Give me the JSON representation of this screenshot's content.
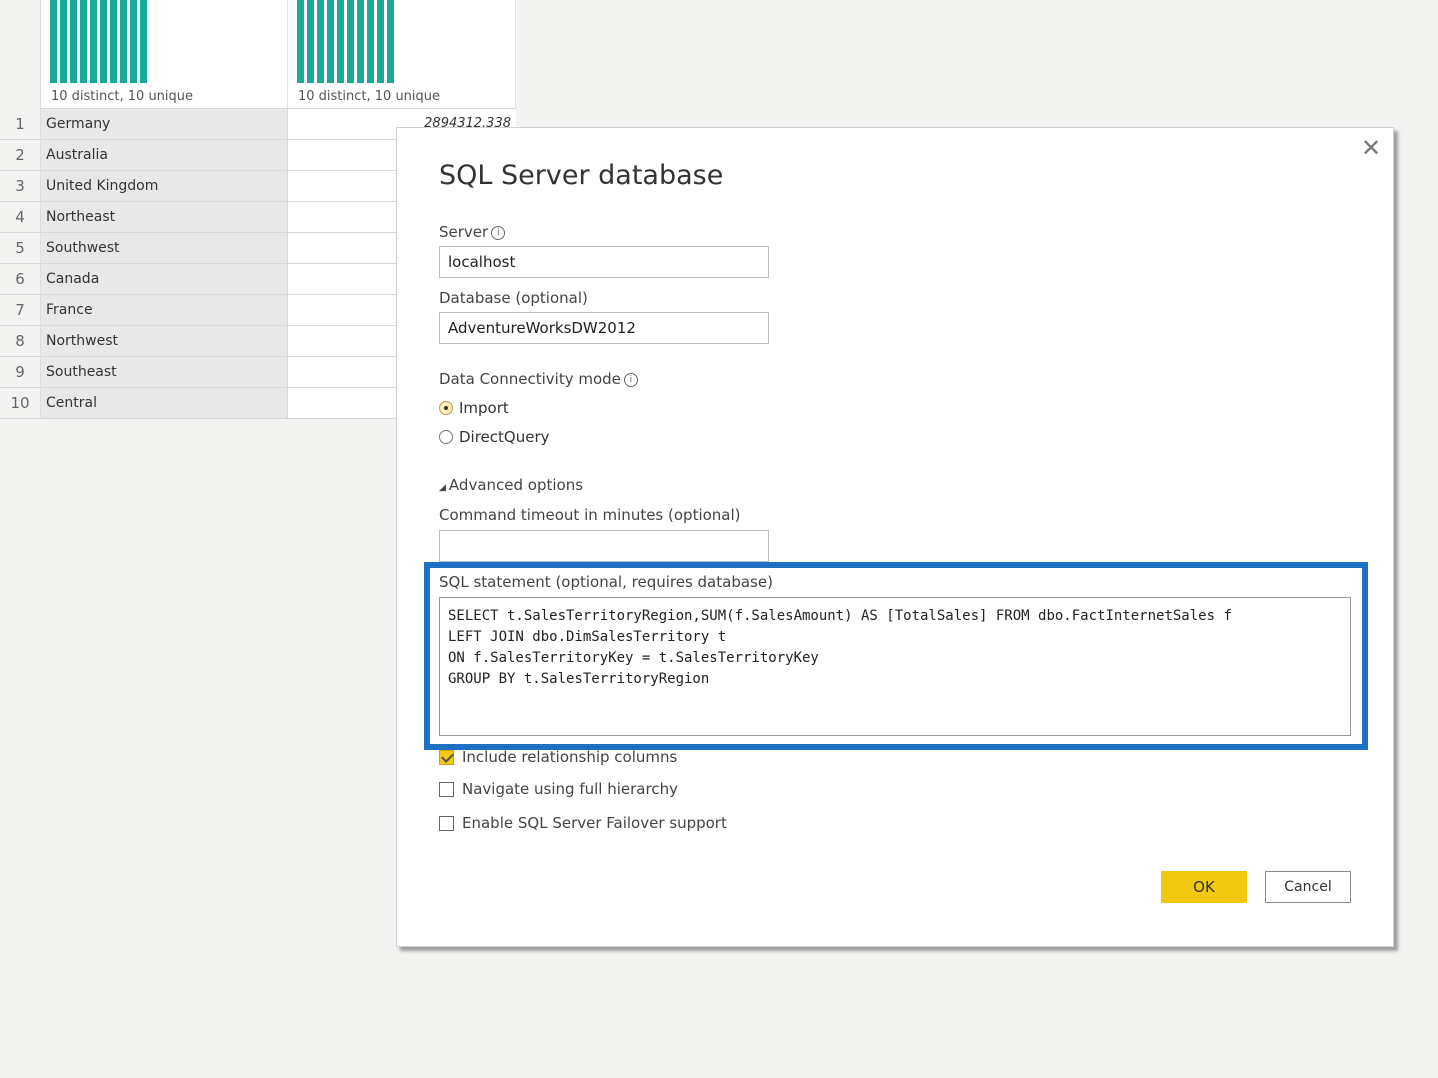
{
  "grid": {
    "columns": [
      {
        "distribution_label": "10 distinct, 10 unique",
        "bar_count": 10
      },
      {
        "distribution_label": "10 distinct, 10 unique",
        "bar_count": 10
      }
    ],
    "rows": [
      {
        "index": "1",
        "region": "Germany",
        "total_sales": "2894312.338"
      },
      {
        "index": "2",
        "region": "Australia",
        "total_sales": ""
      },
      {
        "index": "3",
        "region": "United Kingdom",
        "total_sales": ""
      },
      {
        "index": "4",
        "region": "Northeast",
        "total_sales": ""
      },
      {
        "index": "5",
        "region": "Southwest",
        "total_sales": ""
      },
      {
        "index": "6",
        "region": "Canada",
        "total_sales": ""
      },
      {
        "index": "7",
        "region": "France",
        "total_sales": ""
      },
      {
        "index": "8",
        "region": "Northwest",
        "total_sales": ""
      },
      {
        "index": "9",
        "region": "Southeast",
        "total_sales": ""
      },
      {
        "index": "10",
        "region": "Central",
        "total_sales": ""
      }
    ]
  },
  "dialog": {
    "title": "SQL Server database",
    "close_icon": "close-icon",
    "server_label": "Server",
    "server_value": "localhost",
    "database_label": "Database (optional)",
    "database_value": "AdventureWorksDW2012",
    "connectivity_label": "Data Connectivity mode",
    "info_icon": "i",
    "modes": [
      {
        "label": "Import",
        "selected": true
      },
      {
        "label": "DirectQuery",
        "selected": false
      }
    ],
    "advanced_label": "Advanced options",
    "advanced_icon": "◢",
    "timeout_label": "Command timeout in minutes (optional)",
    "timeout_value": "",
    "sql_label": "SQL statement (optional, requires database)",
    "sql_value": "SELECT t.SalesTerritoryRegion,SUM(f.SalesAmount) AS [TotalSales] FROM dbo.FactInternetSales f\nLEFT JOIN dbo.DimSalesTerritory t\nON f.SalesTerritoryKey = t.SalesTerritoryKey\nGROUP BY t.SalesTerritoryRegion",
    "options": [
      {
        "label": "Include relationship columns",
        "checked": true
      },
      {
        "label": "Navigate using full hierarchy",
        "checked": false
      },
      {
        "label": "Enable SQL Server Failover support",
        "checked": false
      }
    ],
    "ok_label": "OK",
    "cancel_label": "Cancel"
  },
  "colors": {
    "accent_yellow": "#f2c811",
    "highlight_blue": "#1f6fc5",
    "histogram_teal": "#1aaa9b"
  }
}
